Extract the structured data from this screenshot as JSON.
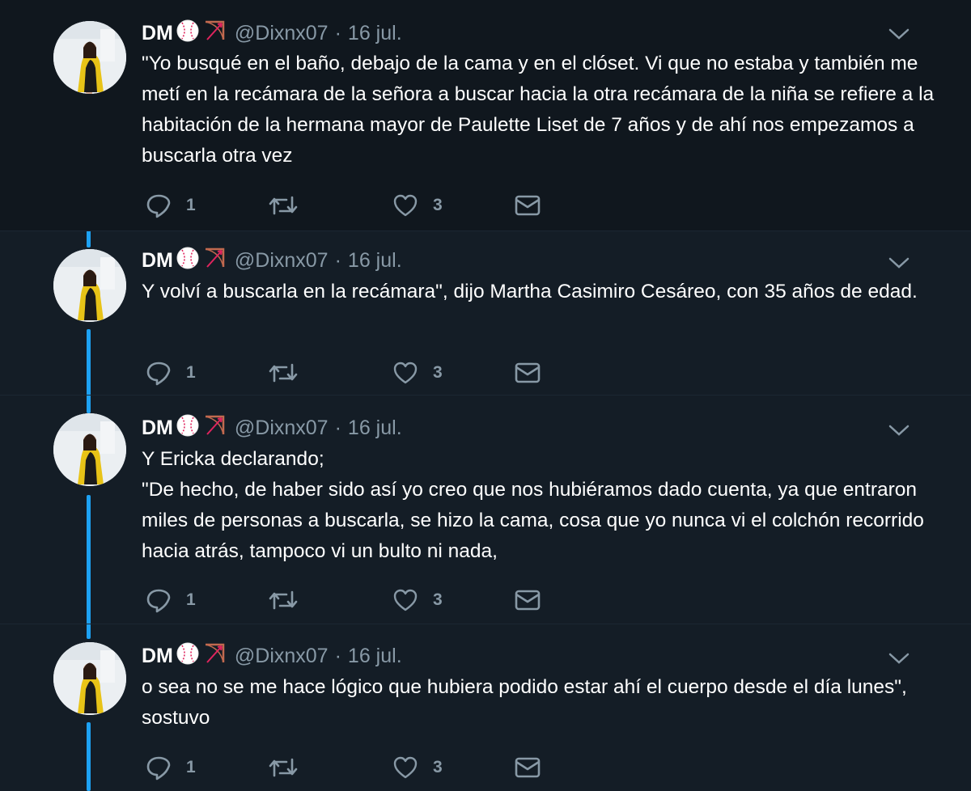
{
  "author": {
    "name": "DM",
    "handle": "@Dixnx07",
    "separator": "·",
    "emoji": [
      "baseball-icon",
      "bow-and-arrow-icon"
    ]
  },
  "colors": {
    "background": "#141d26",
    "first_tweet_background": "#10171e",
    "thread_line": "#1da1f2",
    "secondary_text": "#8899a6"
  },
  "tweets": [
    {
      "date": "16 jul.",
      "paragraphs": [
        "\"Yo busqué en el baño, debajo de la cama y en el clóset. Vi que no estaba y también me metí en la recámara de la señora a buscar hacia la otra recámara de la niña se refiere a la habitación de la hermana mayor de Paulette Liset de 7 años y de ahí nos empezamos a buscarla otra vez"
      ],
      "replies": "1",
      "likes": "3"
    },
    {
      "date": "16 jul.",
      "paragraphs": [
        "Y volví a buscarla en la recámara\", dijo Martha Casimiro Cesáreo, con 35 años de edad."
      ],
      "replies": "1",
      "likes": "3"
    },
    {
      "date": "16 jul.",
      "paragraphs": [
        "Y Ericka declarando;",
        "\"De hecho, de haber sido así yo creo que nos hubiéramos dado cuenta, ya que entraron miles de personas a buscarla, se hizo la cama, cosa que yo nunca vi el colchón recorrido hacia atrás, tampoco vi un bulto ni nada,"
      ],
      "replies": "1",
      "likes": "3"
    },
    {
      "date": "16 jul.",
      "paragraphs": [
        "o sea no se me hace lógico que hubiera podido estar ahí el cuerpo desde el día lunes\", sostuvo"
      ],
      "replies": "1",
      "likes": "3"
    }
  ]
}
